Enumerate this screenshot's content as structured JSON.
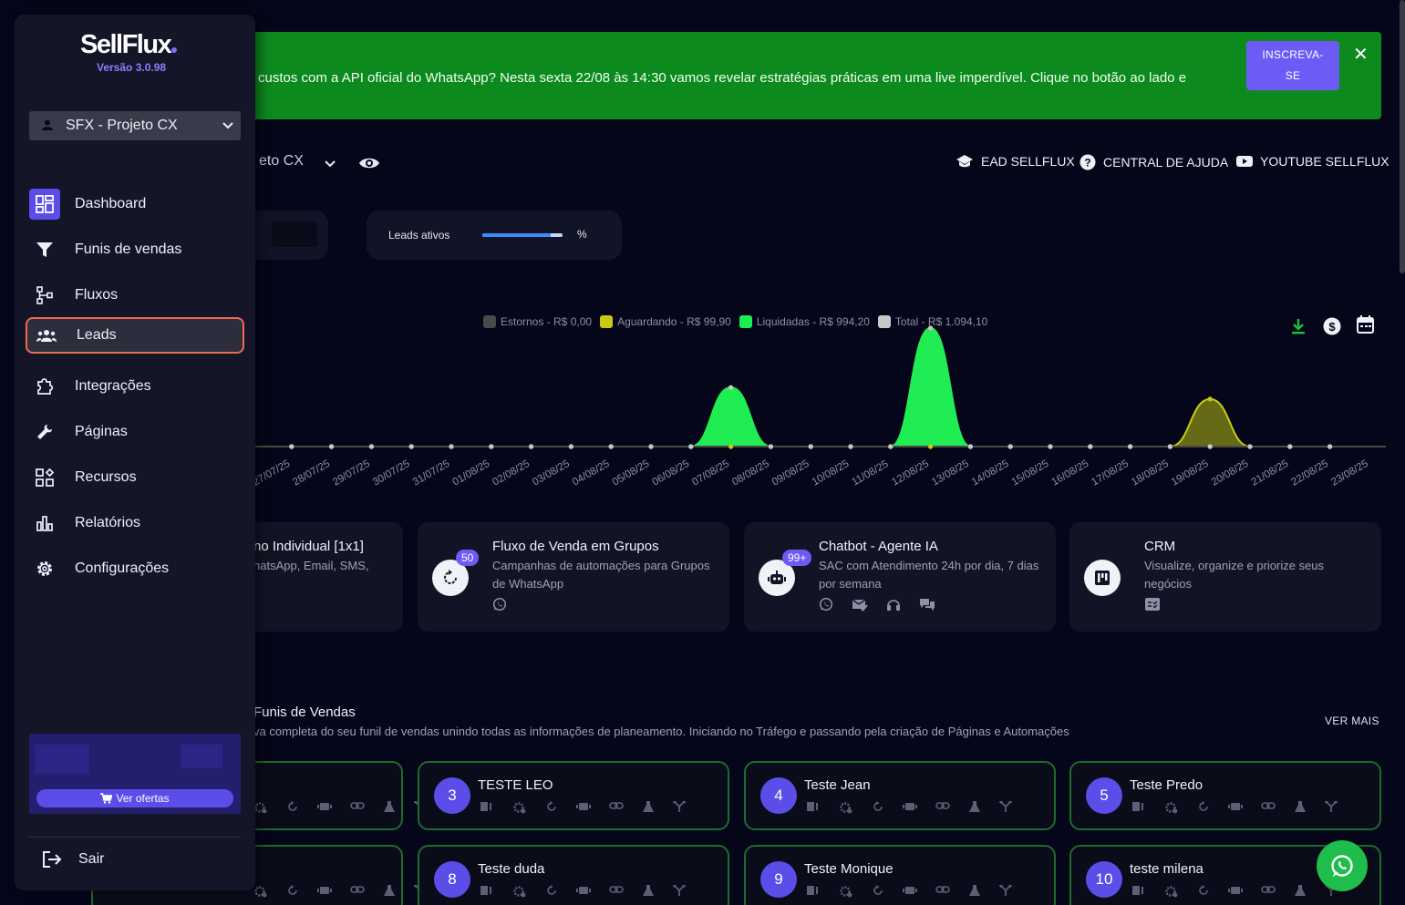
{
  "banner": {
    "text": "custos com a API oficial do WhatsApp? Nesta sexta 22/08 às 14:30 vamos revelar estratégias práticas em uma live imperdível. Clique no botão ao lado e",
    "button_label": "INSCREVA-SE",
    "close_icon": "close-icon",
    "color": "#0c8a1e"
  },
  "header": {
    "project_select": "eto CX",
    "links": [
      {
        "label": "EAD SELLFLUX",
        "icon": "graduation-cap-icon"
      },
      {
        "label": "CENTRAL DE AJUDA",
        "icon": "help-circle-icon"
      },
      {
        "label": "YOUTUBE SELLFLUX",
        "icon": "youtube-icon"
      }
    ]
  },
  "stats": {
    "leads_label": "Leads ativos",
    "leads_percent_symbol": "%",
    "leads_progress": 0.85
  },
  "chart_data": {
    "type": "area",
    "x": [
      "27/07/25",
      "28/07/25",
      "29/07/25",
      "30/07/25",
      "31/07/25",
      "01/08/25",
      "02/08/25",
      "03/08/25",
      "04/08/25",
      "05/08/25",
      "06/08/25",
      "07/08/25",
      "08/08/25",
      "09/08/25",
      "10/08/25",
      "11/08/25",
      "12/08/25",
      "13/08/25",
      "14/08/25",
      "15/08/25",
      "16/08/25",
      "17/08/25",
      "18/08/25",
      "19/08/25",
      "20/08/25",
      "21/08/25",
      "22/08/25",
      "23/08/25"
    ],
    "series": [
      {
        "name": "Estornos - R$ 0,00",
        "color": "#4a4a4a",
        "values": [
          0,
          0,
          0,
          0,
          0,
          0,
          0,
          0,
          0,
          0,
          0,
          0,
          0,
          0,
          0,
          0,
          0,
          0,
          0,
          0,
          0,
          0,
          0,
          0,
          0,
          0,
          0,
          0
        ]
      },
      {
        "name": "Aguardando - R$ 99,90",
        "color": "#c8cc10",
        "values": [
          0,
          0,
          0,
          0,
          0,
          0,
          0,
          0,
          0,
          0,
          0,
          0,
          0,
          0,
          0,
          0,
          0,
          0,
          0,
          0,
          0,
          0,
          0,
          0,
          99.9,
          0,
          0,
          0
        ]
      },
      {
        "name": "Liquidadas - R$ 994,20",
        "color": "#19f050",
        "values": [
          0,
          0,
          0,
          0,
          0,
          0,
          0,
          0,
          0,
          0,
          0,
          0,
          124,
          0,
          0,
          0,
          0,
          249,
          0,
          0,
          0,
          0,
          0,
          0,
          0,
          0,
          0,
          0
        ]
      },
      {
        "name": "Total - R$ 1.094,10",
        "color": "#c8c8c8",
        "values": [
          0,
          0,
          0,
          0,
          0,
          0,
          0,
          0,
          0,
          0,
          0,
          0,
          124,
          0,
          0,
          0,
          0,
          249,
          0,
          0,
          0,
          0,
          0,
          0,
          0,
          0,
          0,
          0
        ]
      }
    ],
    "grid": false,
    "legend_position": "top"
  },
  "chart_tools": [
    {
      "icon": "download-icon",
      "color": "#19c03c"
    },
    {
      "icon": "dollar-icon"
    },
    {
      "icon": "calendar-icon"
    }
  ],
  "feature_cards": [
    {
      "title": "no Individual [1x1]",
      "desc": "hatsApp, Email, SMS,",
      "badge": "",
      "icon": "chat-icon",
      "channels": []
    },
    {
      "title": "Fluxo de Venda em Grupos",
      "desc": "Campanhas de automações para Grupos de WhatsApp",
      "badge": "50",
      "icon": "refresh-icon",
      "channels": [
        "whatsapp-icon"
      ]
    },
    {
      "title": "Chatbot - Agente IA",
      "desc": "SAC com Atendimento 24h por dia, 7 dias por semana",
      "badge": "99+",
      "icon": "robot-icon",
      "channels": [
        "whatsapp-icon",
        "mail-check-icon",
        "headset-icon",
        "chat-bubbles-icon"
      ]
    },
    {
      "title": "CRM",
      "desc": "Visualize, organize e priorize seus negócios",
      "badge": "",
      "icon": "kanban-icon",
      "channels": [
        "checklist-icon"
      ]
    }
  ],
  "funnels_section": {
    "title": "Funis de Vendas",
    "subtitle": "va completa do seu funil de vendas unindo todas as informações de planeamento. Iniciando no Tráfego e passando pela criação de Páginas e Automações",
    "more_label": "VER MAIS"
  },
  "funnels": [
    {
      "number": "",
      "name": ""
    },
    {
      "number": "3",
      "name": "TESTE LEO"
    },
    {
      "number": "4",
      "name": "Teste Jean"
    },
    {
      "number": "5",
      "name": "Teste Predo"
    },
    {
      "number": "",
      "name": ""
    },
    {
      "number": "8",
      "name": "Teste duda"
    },
    {
      "number": "9",
      "name": "Teste Monique"
    },
    {
      "number": "10",
      "name": "teste milena"
    }
  ],
  "sidebar": {
    "logo": "SellFlux",
    "version": "Versão 3.0.98",
    "project": "SFX - Projeto CX",
    "items": [
      {
        "label": "Dashboard",
        "icon": "dashboard-icon"
      },
      {
        "label": "Funis de vendas",
        "icon": "funnel-icon"
      },
      {
        "label": "Fluxos",
        "icon": "flow-icon"
      },
      {
        "label": "Leads",
        "icon": "users-icon"
      },
      {
        "label": "Integrações",
        "icon": "puzzle-icon"
      },
      {
        "label": "Páginas",
        "icon": "wrench-icon"
      },
      {
        "label": "Recursos",
        "icon": "apps-icon"
      },
      {
        "label": "Relatórios",
        "icon": "bar-chart-icon"
      },
      {
        "label": "Configurações",
        "icon": "gear-icon"
      }
    ],
    "offers_label": "Ver ofertas",
    "logout_label": "Sair",
    "accent": "#5b4ee8"
  }
}
